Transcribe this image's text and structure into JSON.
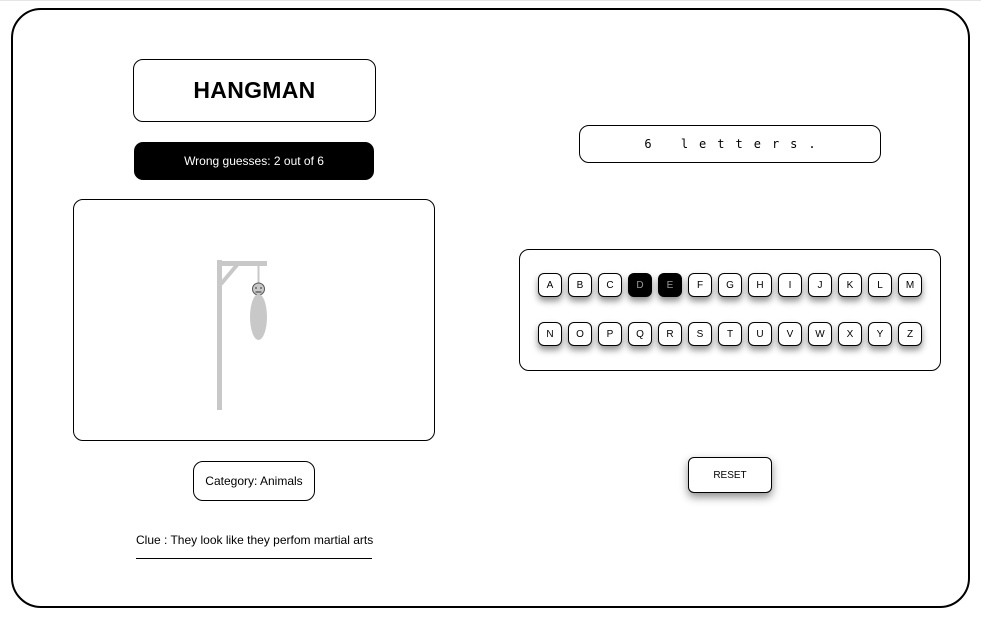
{
  "game": {
    "title": "HANGMAN",
    "wrong_guesses_text": "Wrong guesses: 2 out of 6",
    "wrong_guesses": 2,
    "max_guesses": 6,
    "word_hint": "6 letters.",
    "category_text": "Category: Animals",
    "clue_text": "Clue : They look like they perfom martial arts",
    "reset_label": "RESET"
  },
  "keyboard": {
    "row1": [
      {
        "letter": "A",
        "used": false
      },
      {
        "letter": "B",
        "used": false
      },
      {
        "letter": "C",
        "used": false
      },
      {
        "letter": "D",
        "used": true
      },
      {
        "letter": "E",
        "used": true
      },
      {
        "letter": "F",
        "used": false
      },
      {
        "letter": "G",
        "used": false
      },
      {
        "letter": "H",
        "used": false
      },
      {
        "letter": "I",
        "used": false
      },
      {
        "letter": "J",
        "used": false
      },
      {
        "letter": "K",
        "used": false
      },
      {
        "letter": "L",
        "used": false
      },
      {
        "letter": "M",
        "used": false
      }
    ],
    "row2": [
      {
        "letter": "N",
        "used": false
      },
      {
        "letter": "O",
        "used": false
      },
      {
        "letter": "P",
        "used": false
      },
      {
        "letter": "Q",
        "used": false
      },
      {
        "letter": "R",
        "used": false
      },
      {
        "letter": "S",
        "used": false
      },
      {
        "letter": "T",
        "used": false
      },
      {
        "letter": "U",
        "used": false
      },
      {
        "letter": "V",
        "used": false
      },
      {
        "letter": "W",
        "used": false
      },
      {
        "letter": "X",
        "used": false
      },
      {
        "letter": "Y",
        "used": false
      },
      {
        "letter": "Z",
        "used": false
      }
    ]
  },
  "colors": {
    "gallows": "#c8c8c8",
    "used_key_bg": "#000000",
    "used_key_text": "#9a9a9a"
  }
}
